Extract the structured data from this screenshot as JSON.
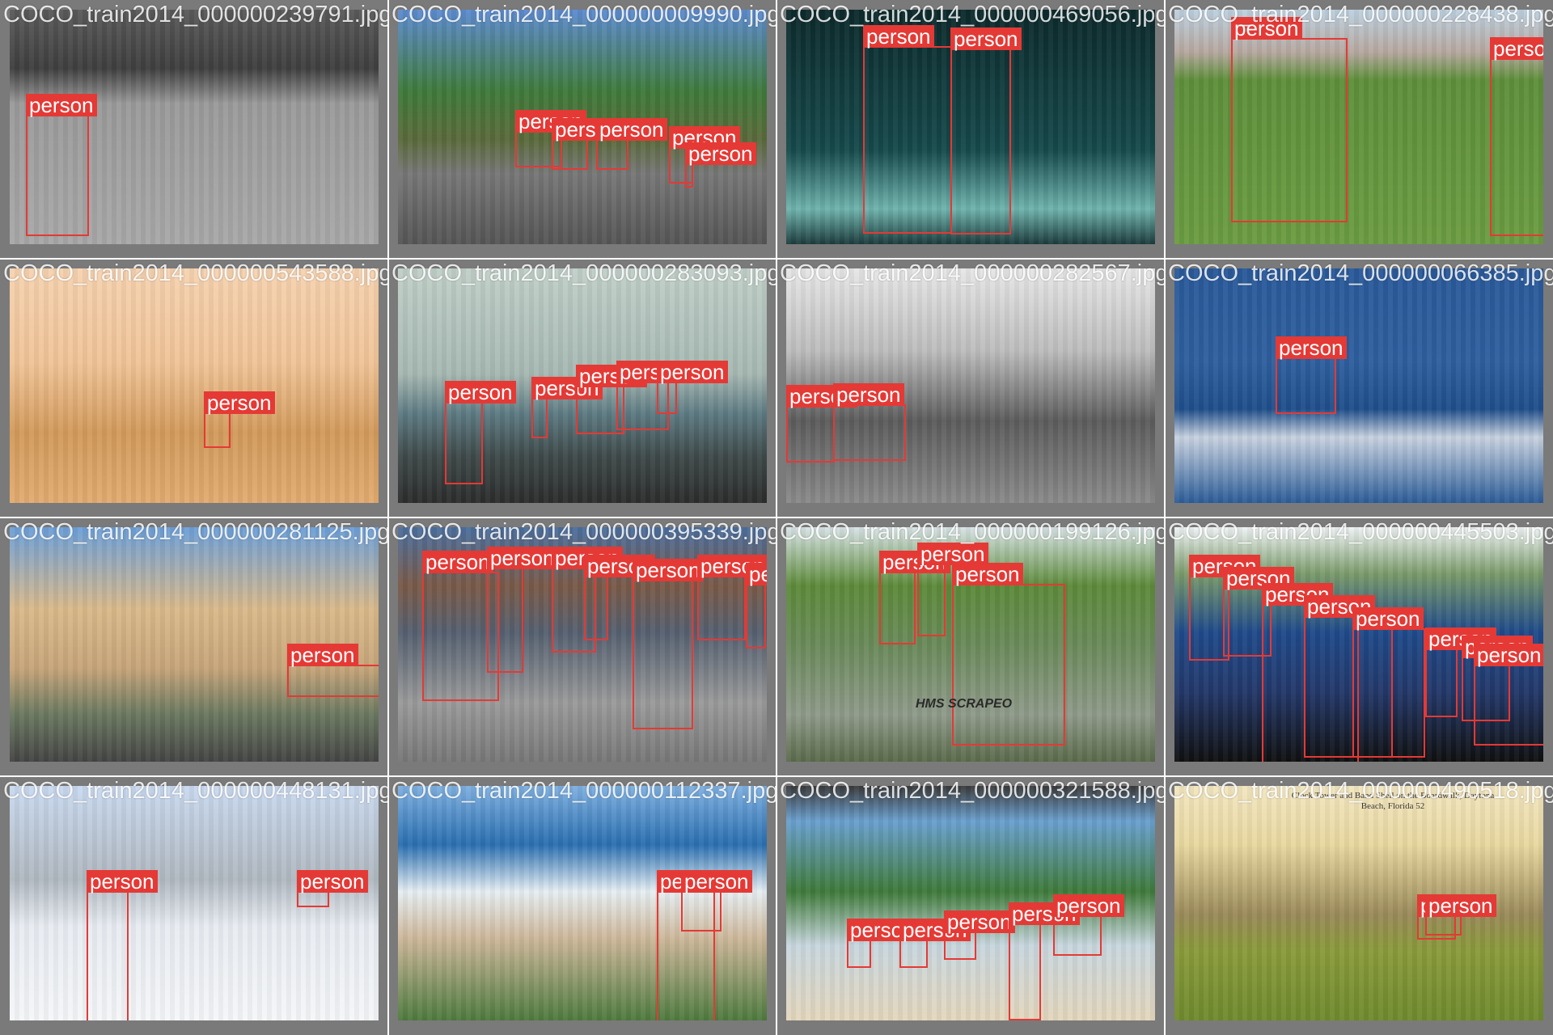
{
  "label_color": "#e53935",
  "cells": [
    {
      "filename": "COCO_train2014_000000239791.jpg",
      "bg": "linear-gradient(180deg,#5a5a5a 0%,#3f3f3f 25%,#9a9a9a 40%,#a8a8a8 100%)",
      "detections": [
        {
          "label": "person"
        }
      ]
    },
    {
      "filename": "COCO_train2014_000000009990.jpg",
      "bg": "linear-gradient(180deg,#5d8bd0 0%,#3f7a3a 35%,#5a6a3a 55%,#777 70%,#555 100%)",
      "detections": [
        {
          "label": "person"
        },
        {
          "label": "person"
        },
        {
          "label": "person"
        },
        {
          "label": "person"
        },
        {
          "label": "person"
        }
      ]
    },
    {
      "filename": "COCO_train2014_000000469056.jpg",
      "bg": "linear-gradient(180deg,#0d2a2c 0%,#16494b 60%,#6fb3ad 85%,#1c3b3c 100%)",
      "detections": [
        {
          "label": "person"
        },
        {
          "label": "person"
        }
      ]
    },
    {
      "filename": "COCO_train2014_000000228438.jpg",
      "bg": "linear-gradient(180deg,#bcd1e0 0%,#b7a8a0 18%,#5e8f3a 30%,#6b9c42 100%)",
      "detections": [
        {
          "label": "person"
        },
        {
          "label": "person"
        }
      ]
    },
    {
      "filename": "COCO_train2014_000000543588.jpg",
      "bg": "linear-gradient(180deg,#f6d2b0 0%,#f0c498 40%,#d29a5c 70%,#e2ac70 100%)",
      "detections": [
        {
          "label": "person"
        }
      ]
    },
    {
      "filename": "COCO_train2014_000000283093.jpg",
      "bg": "linear-gradient(180deg,#c0cfc8 0%,#a7b8b2 45%,#5d7a82 62%,#3f4a4a 80%,#2c2c2c 100%)",
      "detections": [
        {
          "label": "person"
        },
        {
          "label": "person"
        },
        {
          "label": "person"
        },
        {
          "label": "person"
        },
        {
          "label": "person"
        },
        {
          "label": "person"
        }
      ]
    },
    {
      "filename": "COCO_train2014_000000282567.jpg",
      "bg": "linear-gradient(180deg,#e6e6e6 0%,#bdbdbd 35%,#5c5c5c 65%,#8a8a8a 100%)",
      "detections": [
        {
          "label": "person"
        },
        {
          "label": "person"
        }
      ]
    },
    {
      "filename": "COCO_train2014_000000066385.jpg",
      "bg": "linear-gradient(180deg,#2a5a9a 0%,#2e5f9e 40%,#1f4e8a 60%,#c8d2e0 72%,#2b5c97 100%)",
      "detections": [
        {
          "label": "person"
        }
      ]
    },
    {
      "filename": "COCO_train2014_000000281125.jpg",
      "bg": "linear-gradient(180deg,#6c9fd8 0%,#d9b98a 35%,#c7a57a 60%,#6a7860 80%,#444 100%)",
      "detections": [
        {
          "label": "person"
        }
      ]
    },
    {
      "filename": "COCO_train2014_000000395339.jpg",
      "bg": "linear-gradient(180deg,#4b6f9e 0%,#7a5a48 25%,#556070 45%,#9a9a9a 75%,#777 100%)",
      "detections": [
        {
          "label": "person"
        },
        {
          "label": "person"
        },
        {
          "label": "person"
        },
        {
          "label": "person"
        },
        {
          "label": "person"
        },
        {
          "label": "person"
        },
        {
          "label": "person"
        }
      ]
    },
    {
      "filename": "COCO_train2014_000000199126.jpg",
      "bg": "linear-gradient(180deg,#d8e3e6 0%,#5d8a3a 25%,#6a8a5a 50%,#8f9a8a 80%,#5a6a4a 100%)",
      "detections": [
        {
          "label": "person"
        },
        {
          "label": "person"
        },
        {
          "label": "person"
        }
      ]
    },
    {
      "filename": "COCO_train2014_000000445503.jpg",
      "bg": "linear-gradient(180deg,#eef2f4 0%,#7a9a6a 20%,#1f4a8a 45%,#23386a 70%,#101010 100%)",
      "detections": [
        {
          "label": "person"
        },
        {
          "label": "person"
        },
        {
          "label": "person"
        },
        {
          "label": "person"
        },
        {
          "label": "person"
        },
        {
          "label": "person"
        },
        {
          "label": "person"
        },
        {
          "label": "person"
        }
      ]
    },
    {
      "filename": "COCO_train2014_000000448131.jpg",
      "bg": "linear-gradient(180deg,#c9d9ef 0%,#b0b8c0 40%,#e8ecf2 60%,#f4f6f8 100%)",
      "detections": [
        {
          "label": "person"
        },
        {
          "label": "person"
        }
      ]
    },
    {
      "filename": "COCO_train2014_000000112337.jpg",
      "bg": "linear-gradient(180deg,#7fb0e0 0%,#2a6fb0 25%,#e6eef2 45%,#cdb79a 65%,#4e7a3e 100%)",
      "detections": [
        {
          "label": "person"
        },
        {
          "label": "person"
        }
      ]
    },
    {
      "filename": "COCO_train2014_000000321588.jpg",
      "bg": "linear-gradient(180deg,#3a3a3a 0%,#6aa0cf 15%,#3f7a3a 45%,#c8d6de 68%,#e4d6bd 100%)",
      "detections": [
        {
          "label": "person"
        },
        {
          "label": "person"
        },
        {
          "label": "person"
        },
        {
          "label": "person"
        },
        {
          "label": "person"
        }
      ]
    },
    {
      "filename": "COCO_train2014_000000490518.jpg",
      "bg": "linear-gradient(180deg,#f2e6c0 0%,#e8d8a0 25%,#9a8a5a 55%,#8a9a3a 70%,#6f8a2e 100%)",
      "detections": [
        {
          "label": "person"
        },
        {
          "label": "person"
        }
      ]
    }
  ],
  "caption_text": "Clock Tower and Band Shell on the Boardwalk, Daytona Beach, Florida 52",
  "boat_text": "HMS SCRAPEO"
}
